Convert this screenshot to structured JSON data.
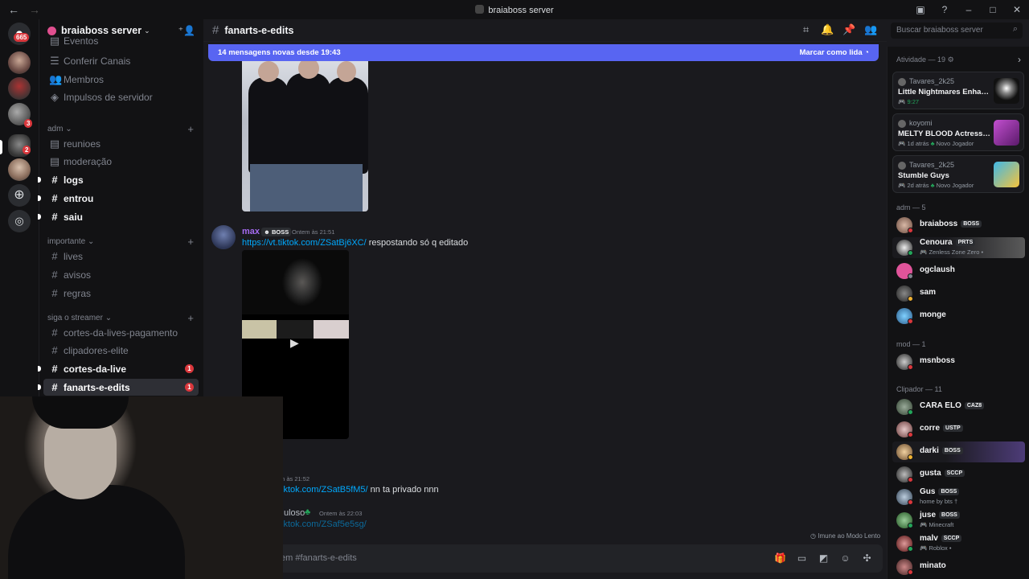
{
  "window": {
    "title": "braiaboss server"
  },
  "rail": {
    "badges": [
      "665",
      "3",
      "2"
    ]
  },
  "server": {
    "name": "braiaboss server"
  },
  "sidebar": {
    "top_items": [
      {
        "label": "Eventos",
        "icon": "calendar-icon"
      },
      {
        "label": "Conferir Canais",
        "icon": "list-icon"
      },
      {
        "label": "Membros",
        "icon": "members-icon"
      },
      {
        "label": "Impulsos de servidor",
        "icon": "boost-icon"
      }
    ],
    "categories": [
      {
        "label": "adm",
        "channels": [
          {
            "label": "reunioes",
            "type": "forum",
            "unread": false
          },
          {
            "label": "moderação",
            "type": "forum",
            "unread": false
          },
          {
            "label": "logs",
            "type": "text",
            "unread": true
          },
          {
            "label": "entrou",
            "type": "text",
            "unread": true
          },
          {
            "label": "saiu",
            "type": "text",
            "unread": true
          }
        ]
      },
      {
        "label": "importante",
        "channels": [
          {
            "label": "lives",
            "type": "text",
            "unread": false
          },
          {
            "label": "avisos",
            "type": "text",
            "unread": false
          },
          {
            "label": "regras",
            "type": "text",
            "unread": false
          }
        ]
      },
      {
        "label": "siga o streamer",
        "channels": [
          {
            "label": "cortes-da-lives-pagamento",
            "type": "text",
            "unread": false
          },
          {
            "label": "clipadores-elite",
            "type": "text",
            "unread": false
          },
          {
            "label": "cortes-da-live",
            "type": "text",
            "unread": true,
            "count": "1"
          },
          {
            "label": "fanarts-e-edits",
            "type": "text",
            "unread": true,
            "count": "1",
            "active": true
          }
        ]
      }
    ]
  },
  "chat": {
    "channel": "fanarts-e-edits",
    "search_placeholder": "Buscar braiaboss server",
    "banner": {
      "text": "14 mensagens novas desde 19:43",
      "action": "Marcar como lida"
    },
    "messages": [
      {
        "author": "max",
        "tag": "BOSS",
        "time": "Ontem às 21:51",
        "link": "https://vt.tiktok.com/ZSatBj6XC/",
        "text": " respostando só q editado"
      },
      {
        "time": "m às 21:52",
        "link": "iktok.com/ZSatB5fM5/",
        "text": " nn ta privado nnn"
      },
      {
        "author": "uloso",
        "time": "Ontem às 22:03",
        "link": "iktok.com/ZSaf5e5sg/"
      }
    ],
    "slowmode": "Imune ao Modo Lento",
    "composer_placeholder": "em #fanarts-e-edits"
  },
  "activity": {
    "header": "Atividade — 19",
    "cards": [
      {
        "user": "Tavares_2k25",
        "game": "Little Nightmares Enhanced Edition",
        "meta": "9:27",
        "extra": ""
      },
      {
        "user": "koyomi",
        "game": "MELTY BLOOD Actress Again Current Code",
        "meta": "1d atrás",
        "extra": "Novo Jogador"
      },
      {
        "user": "Tavares_2k25",
        "game": "Stumble Guys",
        "meta": "2d atrás",
        "extra": "Novo Jogador"
      }
    ]
  },
  "members": {
    "groups": [
      {
        "header": "adm — 5",
        "items": [
          {
            "name": "braiaboss",
            "tag": "BOSS",
            "sub": ""
          },
          {
            "name": "Cenoura",
            "tag": "PRTS",
            "sub": "Zenless Zone Zero •"
          },
          {
            "name": "ogclaush",
            "tag": "",
            "sub": ""
          },
          {
            "name": "sam",
            "tag": "",
            "sub": ""
          },
          {
            "name": "monge",
            "tag": "",
            "sub": ""
          }
        ]
      },
      {
        "header": "mod — 1",
        "items": [
          {
            "name": "msnboss",
            "tag": "",
            "sub": ""
          }
        ]
      },
      {
        "header": "Clipador — 11",
        "items": [
          {
            "name": "CARA ELO",
            "tag": "CAZ8",
            "sub": ""
          },
          {
            "name": "corre",
            "tag": "USTP",
            "sub": ""
          },
          {
            "name": "darki",
            "tag": "BOSS",
            "sub": ""
          },
          {
            "name": "gusta",
            "tag": "SCCP",
            "sub": ""
          },
          {
            "name": "Gus",
            "tag": "BOSS",
            "sub": "home by bts †"
          },
          {
            "name": "juse",
            "tag": "BOSS",
            "sub": "Minecraft"
          },
          {
            "name": "malv",
            "tag": "SCCP",
            "sub": "Roblox •"
          },
          {
            "name": "minato",
            "tag": "",
            "sub": ""
          }
        ]
      }
    ]
  },
  "colors": {
    "accent": "#5865f2",
    "link": "#00a8fc",
    "badge": "#da373c",
    "online": "#23a55a"
  }
}
